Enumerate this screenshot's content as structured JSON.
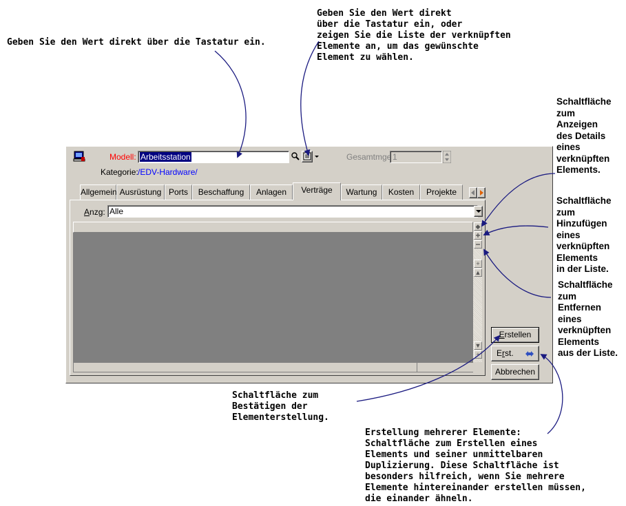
{
  "annotations": {
    "manual_entry": "Geben Sie den Wert direkt über die Tastatur ein.",
    "list_entry": "Geben Sie den Wert direkt\nüber die Tastatur ein, oder\nzeigen Sie die Liste der verknüpften\nElemente an, um das gewünschte\nElement zu wählen.",
    "detail_button": "Schaltfläche\nzum\nAnzeigen\ndes Details\neines\nverknüpften\nElements.",
    "add_button": "Schaltfläche\nzum\nHinzufügen\neines\nverknüpften\nElements\nin der Liste.",
    "remove_button": "Schaltfläche\nzum\nEntfernen\neines\nverknüpften\nElements\naus der Liste.",
    "create_button": "Schaltfläche zum\nBestätigen der\nElementerstellung.",
    "create_multiple": "Erstellung mehrerer Elemente:\nSchaltfläche zum Erstellen eines\nElements und seiner unmittelbaren\nDuplizierung. Diese Schaltfläche ist\nbesonders hilfreich, wenn Sie mehrere\nElemente hintereinander erstellen müssen,\ndie einander ähneln."
  },
  "dialog": {
    "model_label": "Modell:",
    "model_value": "Arbeitsstation",
    "total_label": "Gesamtmge:",
    "total_value": "1",
    "category_label": "Kategorie:",
    "category_value": "/EDV-Hardware/",
    "tabs": [
      "Allgemein",
      "Ausrüstung",
      "Ports",
      "Beschaffung",
      "Anlagen",
      "Verträge",
      "Wartung",
      "Kosten",
      "Projekte"
    ],
    "active_tab": "Verträge",
    "filter_label": "Anzg:",
    "filter_value": "Alle",
    "buttons": {
      "create": "Erstellen",
      "create_multiple": "Erst.",
      "cancel": "Abbrechen"
    }
  },
  "colors": {
    "dialog_bg": "#d4d0c8",
    "list_bg": "#808080",
    "model_label": "#ff0000",
    "category_link": "#0000ff",
    "arrow": "#1a1a80"
  }
}
